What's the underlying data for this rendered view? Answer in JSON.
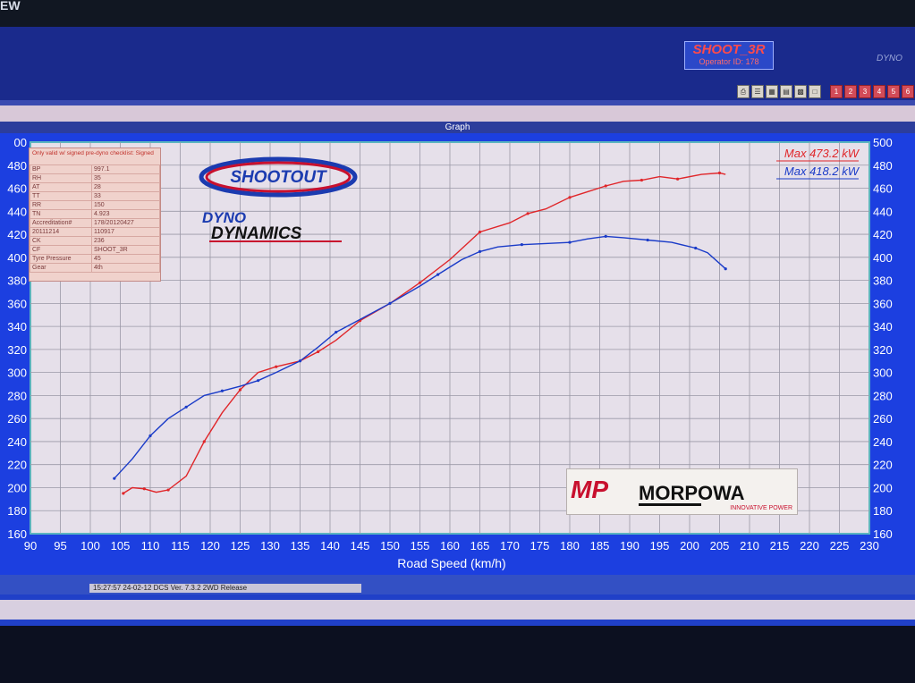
{
  "header": {
    "corner_text": "EW",
    "operator_name": "SHOOT_3R",
    "operator_id": "Operator ID: 178",
    "brand_text": "DYNO",
    "toolbar_icons": [
      "printer-icon",
      "chart-icon",
      "grid-icon",
      "report-icon",
      "table-icon",
      "window-icon"
    ],
    "page_buttons": [
      "1",
      "2",
      "3",
      "4",
      "5",
      "6"
    ]
  },
  "graph_bar": {
    "title": "Graph"
  },
  "info_table": {
    "heading": "Only valid w/ signed pre-dyno checklist: Signed",
    "rows": [
      {
        "k": "BP",
        "v": "997.1"
      },
      {
        "k": "RH",
        "v": "35"
      },
      {
        "k": "AT",
        "v": "28"
      },
      {
        "k": "TT",
        "v": "33"
      },
      {
        "k": "RR",
        "v": "150"
      },
      {
        "k": "TN",
        "v": "4.923"
      },
      {
        "k": "Accreditation#",
        "v": "178/20120427"
      },
      {
        "k": "20111214",
        "v": "110917"
      },
      {
        "k": "CK",
        "v": "236"
      },
      {
        "k": "CF",
        "v": "SHOOT_3R"
      },
      {
        "k": "Tyre Pressure",
        "v": "45"
      },
      {
        "k": "Gear",
        "v": "4th"
      }
    ]
  },
  "logos": {
    "shootout": "SHOOTOUT",
    "dyno1": "DYNO",
    "dyno2": "DYNAMICS",
    "morpowa_mark": "MP",
    "morpowa_name": "MORPOWA",
    "morpowa_tag": "INNOVATIVE POWER"
  },
  "status": {
    "text": "15:27:57     24-02-12  DCS Ver. 7.3.2 2WD Release"
  },
  "chart_data": {
    "type": "line",
    "xlabel": "Road Speed (km/h)",
    "x_ticks": [
      90,
      95,
      100,
      105,
      110,
      115,
      120,
      125,
      130,
      135,
      140,
      145,
      150,
      155,
      160,
      165,
      170,
      175,
      180,
      185,
      190,
      195,
      200,
      205,
      210,
      215,
      220,
      225,
      230
    ],
    "xlim": [
      90,
      230
    ],
    "ylim": [
      160,
      500
    ],
    "y_ticks": [
      160,
      180,
      200,
      220,
      240,
      260,
      280,
      300,
      320,
      340,
      360,
      380,
      400,
      420,
      440,
      460,
      480,
      500
    ],
    "left_tick_labels": [
      "160",
      "180",
      "200",
      "220",
      "240",
      "260",
      "280",
      "300",
      "320",
      "340",
      "360",
      "380",
      "400",
      "420",
      "440",
      "460",
      "480",
      "00"
    ],
    "grid": true,
    "legend": [
      {
        "label": "Max 473.2 kW",
        "color": "#e0262a"
      },
      {
        "label": "Max 418.2 kW",
        "color": "#1a3bc8"
      }
    ],
    "series": [
      {
        "color": "#e0262a",
        "points": [
          [
            105.5,
            195
          ],
          [
            107,
            200
          ],
          [
            109,
            199
          ],
          [
            111,
            196
          ],
          [
            113,
            198
          ],
          [
            116,
            210
          ],
          [
            119,
            240
          ],
          [
            122,
            265
          ],
          [
            125,
            285
          ],
          [
            128,
            300
          ],
          [
            131,
            305
          ],
          [
            135,
            310
          ],
          [
            138,
            318
          ],
          [
            141,
            328
          ],
          [
            145,
            345
          ],
          [
            150,
            360
          ],
          [
            155,
            378
          ],
          [
            160,
            398
          ],
          [
            165,
            422
          ],
          [
            170,
            430
          ],
          [
            173,
            438
          ],
          [
            176,
            442
          ],
          [
            180,
            452
          ],
          [
            183,
            457
          ],
          [
            186,
            462
          ],
          [
            189,
            466
          ],
          [
            192,
            467
          ],
          [
            195,
            470
          ],
          [
            198,
            468
          ],
          [
            202,
            472
          ],
          [
            205,
            473.2
          ],
          [
            206,
            472
          ]
        ]
      },
      {
        "color": "#1a3bc8",
        "points": [
          [
            104,
            208
          ],
          [
            107,
            225
          ],
          [
            110,
            245
          ],
          [
            113,
            260
          ],
          [
            116,
            270
          ],
          [
            119,
            280
          ],
          [
            122,
            284
          ],
          [
            125,
            288
          ],
          [
            128,
            293
          ],
          [
            131,
            300
          ],
          [
            135,
            310
          ],
          [
            138,
            322
          ],
          [
            141,
            335
          ],
          [
            145,
            346
          ],
          [
            150,
            360
          ],
          [
            155,
            375
          ],
          [
            158,
            385
          ],
          [
            162,
            398
          ],
          [
            165,
            405
          ],
          [
            168,
            409
          ],
          [
            172,
            411
          ],
          [
            176,
            412
          ],
          [
            180,
            413
          ],
          [
            183,
            416
          ],
          [
            186,
            418.2
          ],
          [
            189,
            417
          ],
          [
            193,
            415
          ],
          [
            197,
            413
          ],
          [
            201,
            408
          ],
          [
            203,
            404
          ],
          [
            206,
            390
          ]
        ]
      }
    ]
  }
}
